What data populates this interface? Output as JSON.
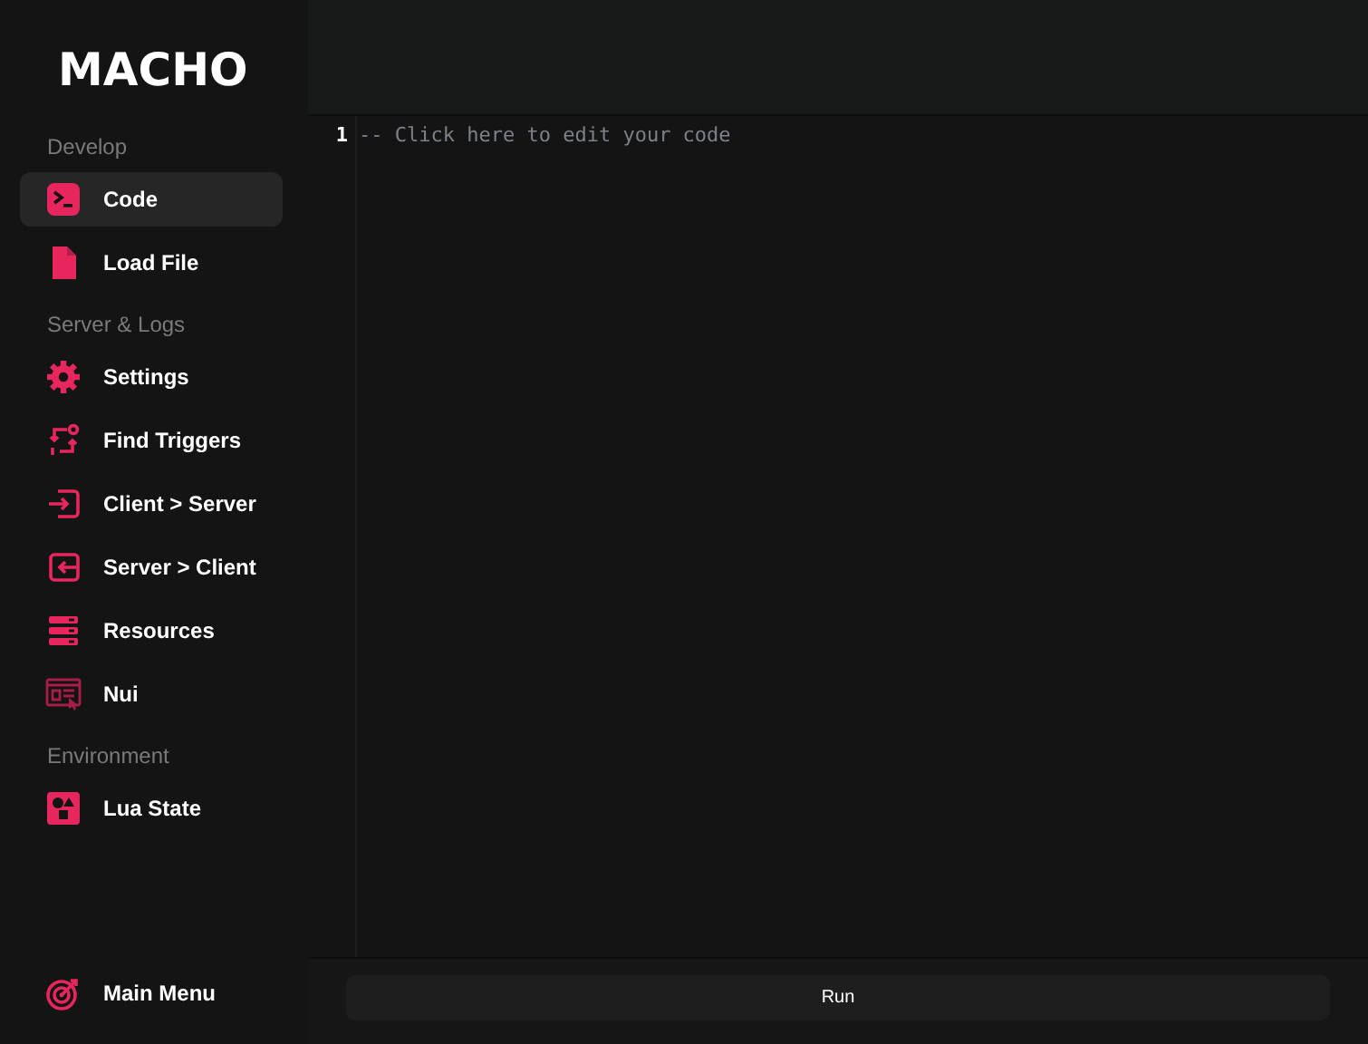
{
  "logo": "MACHO",
  "sections": [
    {
      "title": "Develop",
      "items": [
        {
          "label": "Code",
          "selected": true
        },
        {
          "label": "Load File",
          "selected": false
        }
      ]
    },
    {
      "title": "Server & Logs",
      "items": [
        {
          "label": "Settings",
          "selected": false
        },
        {
          "label": "Find Triggers",
          "selected": false
        },
        {
          "label": "Client > Server",
          "selected": false
        },
        {
          "label": "Server > Client",
          "selected": false
        },
        {
          "label": "Resources",
          "selected": false
        },
        {
          "label": "Nui",
          "selected": false
        }
      ]
    },
    {
      "title": "Environment",
      "items": [
        {
          "label": "Lua State",
          "selected": false
        }
      ]
    }
  ],
  "footer_item": {
    "label": "Main Menu"
  },
  "editor": {
    "line_number": "1",
    "placeholder": "-- Click here to edit your code"
  },
  "run_button": "Run"
}
